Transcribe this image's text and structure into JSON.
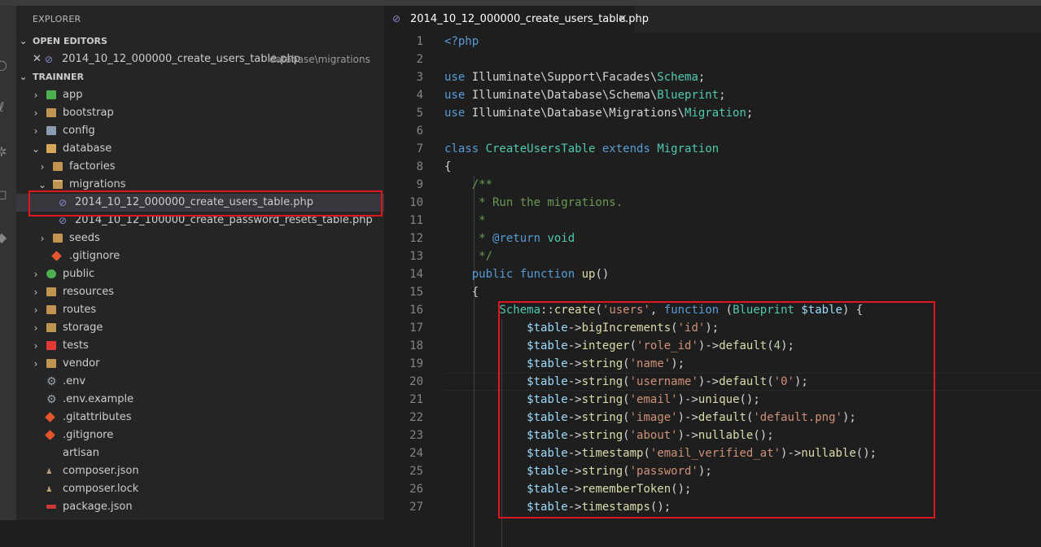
{
  "sidebar": {
    "title": "EXPLORER",
    "open_editors_label": "OPEN EDITORS",
    "open_editor": {
      "file": "2014_10_12_000000_create_users_table.php",
      "path": "database\\migrations"
    },
    "project_label": "TRAINNER",
    "tree": [
      {
        "label": "app",
        "indent": 0,
        "chev": "›",
        "icon": "app-folder-icon"
      },
      {
        "label": "bootstrap",
        "indent": 0,
        "chev": "›",
        "icon": "folder-icon"
      },
      {
        "label": "config",
        "indent": 0,
        "chev": "›",
        "icon": "config-folder-icon"
      },
      {
        "label": "database",
        "indent": 0,
        "chev": "⌄",
        "icon": "database-folder-icon"
      },
      {
        "label": "factories",
        "indent": 1,
        "chev": "›",
        "icon": "folder-icon"
      },
      {
        "label": "migrations",
        "indent": 1,
        "chev": "⌄",
        "icon": "folder-open-icon"
      },
      {
        "label": "2014_10_12_000000_create_users_table.php",
        "indent": 2,
        "chev": "",
        "icon": "php-icon",
        "selected": true
      },
      {
        "label": "2014_10_12_100000_create_password_resets_table.php",
        "indent": 2,
        "chev": "",
        "icon": "php-icon"
      },
      {
        "label": "seeds",
        "indent": 1,
        "chev": "›",
        "icon": "folder-icon"
      },
      {
        "label": ".gitignore",
        "indent": 1,
        "chev": "",
        "icon": "git-icon"
      },
      {
        "label": "public",
        "indent": 0,
        "chev": "›",
        "icon": "public-folder-icon"
      },
      {
        "label": "resources",
        "indent": 0,
        "chev": "›",
        "icon": "folder-icon"
      },
      {
        "label": "routes",
        "indent": 0,
        "chev": "›",
        "icon": "folder-icon"
      },
      {
        "label": "storage",
        "indent": 0,
        "chev": "›",
        "icon": "folder-icon"
      },
      {
        "label": "tests",
        "indent": 0,
        "chev": "›",
        "icon": "tests-folder-icon"
      },
      {
        "label": "vendor",
        "indent": 0,
        "chev": "›",
        "icon": "folder-icon"
      },
      {
        "label": ".env",
        "indent": 0,
        "chev": "",
        "icon": "gear-icon"
      },
      {
        "label": ".env.example",
        "indent": 0,
        "chev": "",
        "icon": "gear-icon"
      },
      {
        "label": ".gitattributes",
        "indent": 0,
        "chev": "",
        "icon": "git-icon"
      },
      {
        "label": ".gitignore",
        "indent": 0,
        "chev": "",
        "icon": "git-icon"
      },
      {
        "label": "artisan",
        "indent": 0,
        "chev": "",
        "icon": "file-icon"
      },
      {
        "label": "composer.json",
        "indent": 0,
        "chev": "",
        "icon": "composer-icon"
      },
      {
        "label": "composer.lock",
        "indent": 0,
        "chev": "",
        "icon": "composer-icon"
      },
      {
        "label": "package.json",
        "indent": 0,
        "chev": "",
        "icon": "npm-icon"
      }
    ]
  },
  "editor": {
    "tab_label": "2014_10_12_000000_create_users_table.php",
    "tab_close": "×",
    "lines": [
      {
        "n": "1",
        "tokens": [
          [
            "k",
            "<?php"
          ]
        ]
      },
      {
        "n": "2",
        "tokens": []
      },
      {
        "n": "3",
        "tokens": [
          [
            "k",
            "use "
          ],
          [
            "p",
            "Illuminate\\Support\\Facades\\"
          ],
          [
            "t",
            "Schema"
          ],
          [
            "p",
            ";"
          ]
        ]
      },
      {
        "n": "4",
        "tokens": [
          [
            "k",
            "use "
          ],
          [
            "p",
            "Illuminate\\Database\\Schema\\"
          ],
          [
            "t",
            "Blueprint"
          ],
          [
            "p",
            ";"
          ]
        ]
      },
      {
        "n": "5",
        "tokens": [
          [
            "k",
            "use "
          ],
          [
            "p",
            "Illuminate\\Database\\Migrations\\"
          ],
          [
            "t",
            "Migration"
          ],
          [
            "p",
            ";"
          ]
        ]
      },
      {
        "n": "6",
        "tokens": []
      },
      {
        "n": "7",
        "tokens": [
          [
            "k",
            "class "
          ],
          [
            "t",
            "CreateUsersTable "
          ],
          [
            "k",
            "extends "
          ],
          [
            "t",
            "Migration"
          ]
        ]
      },
      {
        "n": "8",
        "tokens": [
          [
            "p",
            "{"
          ]
        ]
      },
      {
        "n": "9",
        "tokens": [
          [
            "p",
            "    "
          ],
          [
            "c",
            "/**"
          ]
        ]
      },
      {
        "n": "10",
        "tokens": [
          [
            "p",
            "    "
          ],
          [
            "c",
            " * Run the migrations."
          ]
        ]
      },
      {
        "n": "11",
        "tokens": [
          [
            "p",
            "    "
          ],
          [
            "c",
            " *"
          ]
        ]
      },
      {
        "n": "12",
        "tokens": [
          [
            "p",
            "    "
          ],
          [
            "c",
            " * "
          ],
          [
            "k",
            "@return "
          ],
          [
            "t",
            "void"
          ]
        ]
      },
      {
        "n": "13",
        "tokens": [
          [
            "p",
            "    "
          ],
          [
            "c",
            " */"
          ]
        ]
      },
      {
        "n": "14",
        "tokens": [
          [
            "p",
            "    "
          ],
          [
            "k",
            "public "
          ],
          [
            "k",
            "function "
          ],
          [
            "f",
            "up"
          ],
          [
            "p",
            "()"
          ]
        ]
      },
      {
        "n": "15",
        "tokens": [
          [
            "p",
            "    {"
          ]
        ]
      },
      {
        "n": "16",
        "tokens": [
          [
            "p",
            "        "
          ],
          [
            "t",
            "Schema"
          ],
          [
            "p",
            "::"
          ],
          [
            "f",
            "create"
          ],
          [
            "p",
            "("
          ],
          [
            "s",
            "'users'"
          ],
          [
            "p",
            ", "
          ],
          [
            "k",
            "function "
          ],
          [
            "p",
            "("
          ],
          [
            "t",
            "Blueprint "
          ],
          [
            "v",
            "$table"
          ],
          [
            "p",
            ") {"
          ]
        ]
      },
      {
        "n": "17",
        "tokens": [
          [
            "p",
            "            "
          ],
          [
            "v",
            "$table"
          ],
          [
            "p",
            "->"
          ],
          [
            "f",
            "bigIncrements"
          ],
          [
            "p",
            "("
          ],
          [
            "s",
            "'id'"
          ],
          [
            "p",
            ");"
          ]
        ]
      },
      {
        "n": "18",
        "tokens": [
          [
            "p",
            "            "
          ],
          [
            "v",
            "$table"
          ],
          [
            "p",
            "->"
          ],
          [
            "f",
            "integer"
          ],
          [
            "p",
            "("
          ],
          [
            "s",
            "'role_id'"
          ],
          [
            "p",
            ")->"
          ],
          [
            "f",
            "default"
          ],
          [
            "p",
            "("
          ],
          [
            "n",
            "4"
          ],
          [
            "p",
            ");"
          ]
        ]
      },
      {
        "n": "19",
        "tokens": [
          [
            "p",
            "            "
          ],
          [
            "v",
            "$table"
          ],
          [
            "p",
            "->"
          ],
          [
            "f",
            "string"
          ],
          [
            "p",
            "("
          ],
          [
            "s",
            "'name'"
          ],
          [
            "p",
            ");"
          ]
        ]
      },
      {
        "n": "20",
        "tokens": [
          [
            "p",
            "            "
          ],
          [
            "v",
            "$table"
          ],
          [
            "p",
            "->"
          ],
          [
            "f",
            "string"
          ],
          [
            "p",
            "("
          ],
          [
            "s",
            "'username'"
          ],
          [
            "p",
            ")->"
          ],
          [
            "f",
            "default"
          ],
          [
            "p",
            "("
          ],
          [
            "s",
            "'0'"
          ],
          [
            "p",
            ");"
          ]
        ]
      },
      {
        "n": "21",
        "tokens": [
          [
            "p",
            "            "
          ],
          [
            "v",
            "$table"
          ],
          [
            "p",
            "->"
          ],
          [
            "f",
            "string"
          ],
          [
            "p",
            "("
          ],
          [
            "s",
            "'email'"
          ],
          [
            "p",
            ")->"
          ],
          [
            "f",
            "unique"
          ],
          [
            "p",
            "();"
          ]
        ]
      },
      {
        "n": "22",
        "tokens": [
          [
            "p",
            "            "
          ],
          [
            "v",
            "$table"
          ],
          [
            "p",
            "->"
          ],
          [
            "f",
            "string"
          ],
          [
            "p",
            "("
          ],
          [
            "s",
            "'image'"
          ],
          [
            "p",
            ")->"
          ],
          [
            "f",
            "default"
          ],
          [
            "p",
            "("
          ],
          [
            "s",
            "'default.png'"
          ],
          [
            "p",
            ");"
          ]
        ]
      },
      {
        "n": "23",
        "tokens": [
          [
            "p",
            "            "
          ],
          [
            "v",
            "$table"
          ],
          [
            "p",
            "->"
          ],
          [
            "f",
            "string"
          ],
          [
            "p",
            "("
          ],
          [
            "s",
            "'about'"
          ],
          [
            "p",
            ")->"
          ],
          [
            "f",
            "nullable"
          ],
          [
            "p",
            "();"
          ]
        ]
      },
      {
        "n": "24",
        "tokens": [
          [
            "p",
            "            "
          ],
          [
            "v",
            "$table"
          ],
          [
            "p",
            "->"
          ],
          [
            "f",
            "timestamp"
          ],
          [
            "p",
            "("
          ],
          [
            "s",
            "'email_verified_at'"
          ],
          [
            "p",
            ")->"
          ],
          [
            "f",
            "nullable"
          ],
          [
            "p",
            "();"
          ]
        ]
      },
      {
        "n": "25",
        "tokens": [
          [
            "p",
            "            "
          ],
          [
            "v",
            "$table"
          ],
          [
            "p",
            "->"
          ],
          [
            "f",
            "string"
          ],
          [
            "p",
            "("
          ],
          [
            "s",
            "'password'"
          ],
          [
            "p",
            ");"
          ]
        ]
      },
      {
        "n": "26",
        "tokens": [
          [
            "p",
            "            "
          ],
          [
            "v",
            "$table"
          ],
          [
            "p",
            "->"
          ],
          [
            "f",
            "rememberToken"
          ],
          [
            "p",
            "();"
          ]
        ]
      },
      {
        "n": "27",
        "tokens": [
          [
            "p",
            "            "
          ],
          [
            "v",
            "$table"
          ],
          [
            "p",
            "->"
          ],
          [
            "f",
            "timestamps"
          ],
          [
            "p",
            "();"
          ]
        ]
      }
    ]
  }
}
